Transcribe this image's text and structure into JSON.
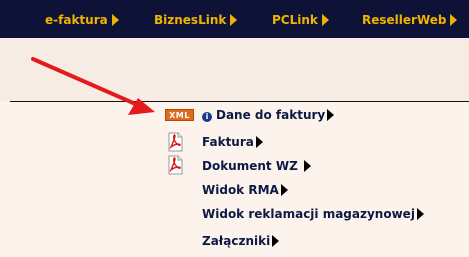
{
  "topnav": {
    "items": [
      {
        "label": "e-faktura"
      },
      {
        "label": "BiznesLink"
      },
      {
        "label": "PCLink"
      },
      {
        "label": "ResellerWeb"
      }
    ]
  },
  "menu": {
    "xml_badge": "XML",
    "info_icon": "i",
    "items": [
      {
        "label": "Dane do faktury",
        "icon": "xml-icon"
      },
      {
        "label": "Faktura",
        "icon": "pdf-icon"
      },
      {
        "label": "Dokument WZ",
        "icon": "pdf-icon"
      },
      {
        "label": "Widok RMA",
        "icon": ""
      },
      {
        "label": "Widok reklamacji magazynowej",
        "icon": ""
      },
      {
        "label": "Załączniki",
        "icon": ""
      }
    ]
  },
  "colors": {
    "topbar": "#0f1237",
    "nav_text": "#f0b400",
    "menu_text": "#0d1a45",
    "annotation_arrow": "#e31b1b"
  }
}
